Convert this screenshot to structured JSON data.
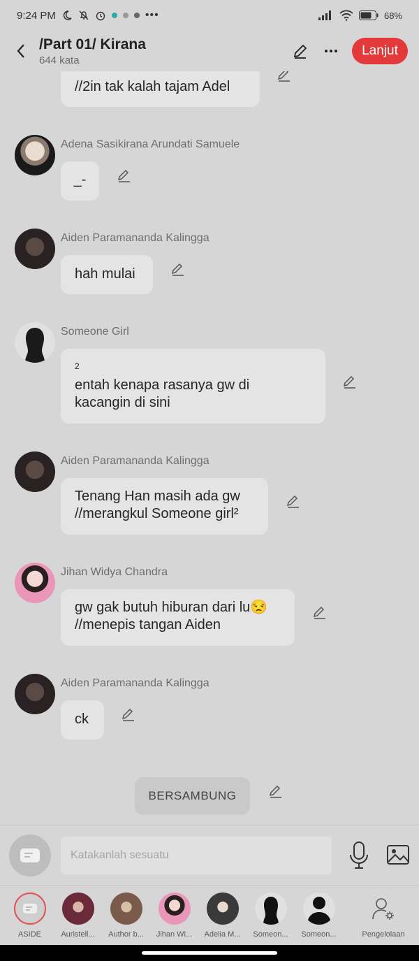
{
  "status_bar": {
    "time": "9:24 PM",
    "battery": "68%"
  },
  "header": {
    "title": "/Part 01/ Kirana",
    "subtitle": "644 kata",
    "continue_label": "Lanjut"
  },
  "messages": [
    {
      "name": "",
      "text": "//2in tak kalah tajam Adel"
    },
    {
      "name": "Adena Sasikirana Arundati Samuele",
      "text": "_-"
    },
    {
      "name": "Aiden Paramananda Kalingga",
      "text": "hah mulai"
    },
    {
      "name": "Someone Girl",
      "sup": "2",
      "line1": "entah kenapa rasanya gw di",
      "line2": "kacangin di sini"
    },
    {
      "name": "Aiden Paramananda Kalingga",
      "line1": "Tenang Han masih ada gw",
      "line2": "//merangkul Someone girl²"
    },
    {
      "name": "Jihan Widya Chandra",
      "line1": "gw gak butuh hiburan dari lu😒",
      "line2": "//menepis tangan Aiden"
    },
    {
      "name": "Aiden Paramananda Kalingga",
      "text": "ck"
    }
  ],
  "narration": "BERSAMBUNG",
  "input": {
    "placeholder": "Katakanlah sesuatu"
  },
  "characters": [
    {
      "label": "ASIDE",
      "color": "#e05252"
    },
    {
      "label": "Auristell...",
      "color": "#6b2a3a"
    },
    {
      "label": "Author b...",
      "color": "#7a5a4a"
    },
    {
      "label": "Jihan Wi...",
      "color": "#e88ab0"
    },
    {
      "label": "Adelia M...",
      "color": "#3a3a3a"
    },
    {
      "label": "Someon...",
      "color": "#111111"
    },
    {
      "label": "Someon...",
      "color": "#111111"
    },
    {
      "label": "Pengelolaan"
    }
  ]
}
